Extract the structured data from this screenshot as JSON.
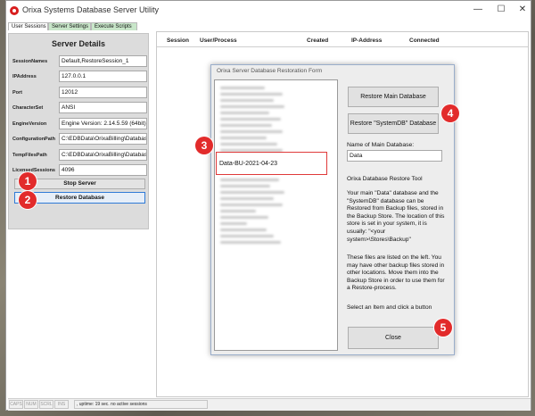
{
  "window": {
    "title": "Orixa Systems Database Server Utility",
    "minimize_glyph": "—",
    "maximize_glyph": "☐",
    "close_glyph": "✕"
  },
  "tabs": [
    {
      "label": "User Sessions",
      "selected": true
    },
    {
      "label": "Server Settings",
      "selected": false
    },
    {
      "label": "Execute Scripts",
      "selected": false
    }
  ],
  "server_details": {
    "title": "Server Details",
    "fields": [
      {
        "label": "SessionNames",
        "value": "Default,RestoreSession_1"
      },
      {
        "label": "IPAddress",
        "value": "127.0.0.1"
      },
      {
        "label": "Port",
        "value": "12012"
      },
      {
        "label": "CharacterSet",
        "value": "ANSI"
      },
      {
        "label": "EngineVersion",
        "value": "Engine Version: 2.14.5.59 (64bit)"
      },
      {
        "label": "ConfigurationPath",
        "value": "C:\\EDBData\\OrixaBilling\\Database"
      },
      {
        "label": "TempFilesPath",
        "value": "C:\\EDBData\\OrixaBilling\\Database"
      },
      {
        "label": "LicensedSessions",
        "value": "4096"
      }
    ],
    "stop_server_label": "Stop Server",
    "restore_database_label": "Restore Database"
  },
  "sessions_table": {
    "columns": [
      "Session",
      "User/Process",
      "Created",
      "IP-Address",
      "Connected"
    ]
  },
  "statusbar": {
    "caps": "CAPS",
    "num": "NUM",
    "scrl": "SCRL",
    "ins": "INS",
    "message": ", uptime: 19 sec. no active sessions"
  },
  "restore_dialog": {
    "title": "Orixa Server Database Restoration Form",
    "selected_backup": "Data-BU-2021-04-23",
    "restore_main_label": "Restore Main Database",
    "restore_sysdb_label": "Restore \"SystemDB\" Database",
    "name_label": "Name of Main Database:",
    "name_value": "Data",
    "tool_heading": "Orixa Database Restore Tool",
    "para1": "Your main \"Data\" database and the \"SystemDB\" database can be Restored from Backup files, stored in the Backup Store. The location of this store is set in your system, it is usually: \"<your system>\\Stores\\Backup\"",
    "para2": "These files are listed on the left. You may have other backup files stored in other locations. Move them into the Backup Store in order to use them for a Restore-process.",
    "para3": "Select an Item and click a button",
    "close_label": "Close"
  },
  "callouts": [
    "1",
    "2",
    "3",
    "4",
    "5"
  ],
  "colors": {
    "callout": "#e22b2b",
    "highlight": "#e03a3a",
    "focus_border": "#2f7ad6"
  }
}
